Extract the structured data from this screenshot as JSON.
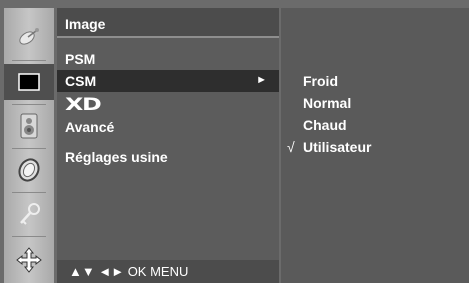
{
  "menu": {
    "title": "Image",
    "items": [
      {
        "label": "PSM"
      },
      {
        "label": "CSM",
        "arrow": "►"
      },
      {
        "label": "XD"
      },
      {
        "label": "Avancé"
      },
      {
        "label": "Réglages usine"
      }
    ]
  },
  "submenu": {
    "check_mark": "√",
    "options": [
      "Froid",
      "Normal",
      "Chaud",
      "Utilisateur"
    ],
    "selected": "Utilisateur"
  },
  "nav_hint": "▲▼  ◄►  OK  MENU",
  "icons": [
    "satellite-dish-icon",
    "picture-icon",
    "speaker-icon",
    "clock-icon",
    "key-icon",
    "settings-arrows-icon"
  ]
}
